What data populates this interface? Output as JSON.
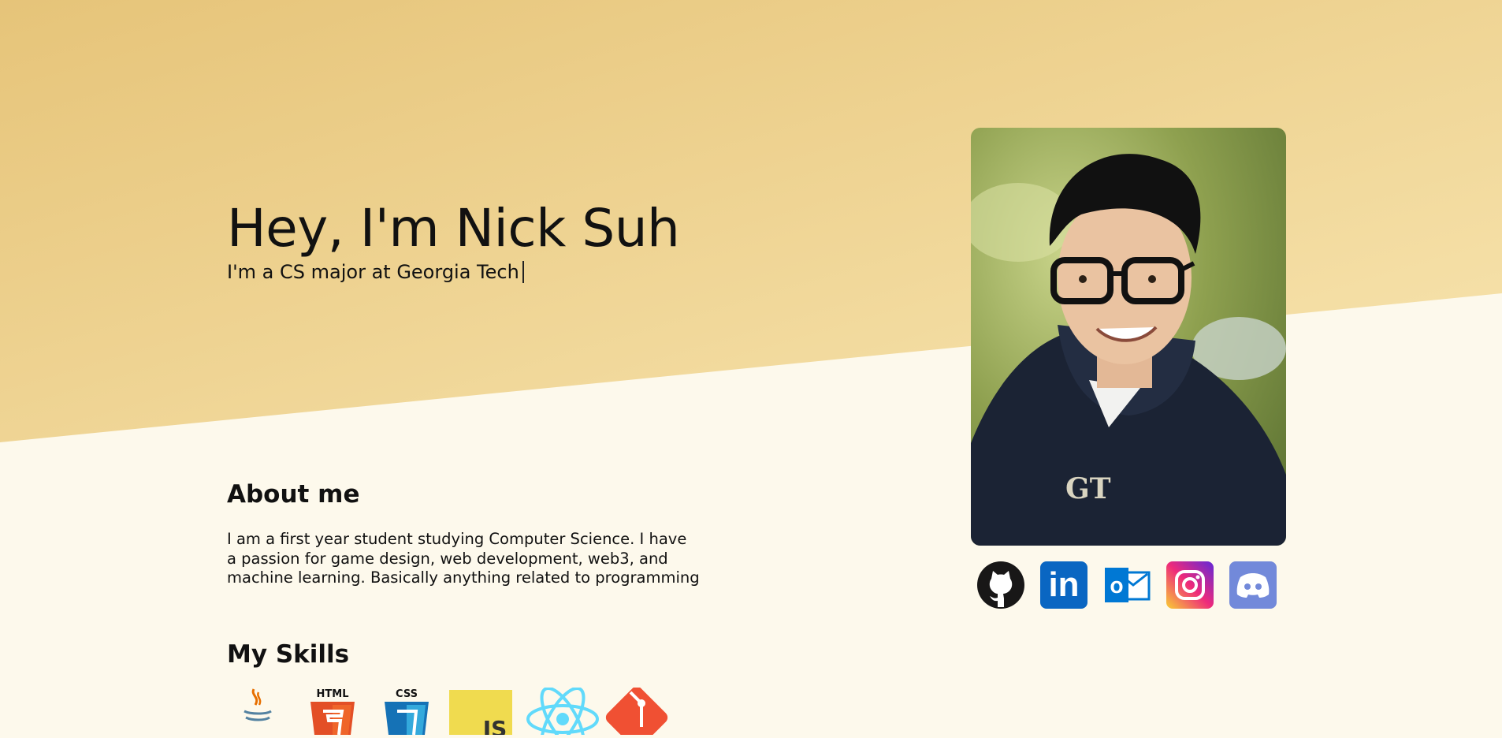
{
  "hero": {
    "title": "Hey, I'm Nick Suh",
    "subtitle": "I'm a CS major at Georgia Tech"
  },
  "about": {
    "heading": "About me",
    "text": "I am a first year student studying Computer Science. I have a passion for game design, web development, web3, and machine learning. Basically anything related to programming"
  },
  "skills": {
    "heading": "My Skills",
    "items": [
      {
        "icon": "java-icon",
        "color": "#e76f00"
      },
      {
        "icon": "html5-icon",
        "label": "HTML",
        "color": "#e34f26"
      },
      {
        "icon": "css3-icon",
        "label": "CSS",
        "color": "#1572b6"
      },
      {
        "icon": "javascript-icon",
        "label": "JS",
        "color": "#f0db4f"
      },
      {
        "icon": "react-icon",
        "color": "#61dafb"
      },
      {
        "icon": "git-icon",
        "color": "#f05033"
      }
    ]
  },
  "social": [
    {
      "icon": "github-icon",
      "color": "#181717"
    },
    {
      "icon": "linkedin-icon",
      "label": "in",
      "color": "#0a66c2"
    },
    {
      "icon": "outlook-icon",
      "label": "O",
      "color": "#0078d4"
    },
    {
      "icon": "instagram-icon",
      "color": "#d6249f"
    },
    {
      "icon": "discord-icon",
      "color": "#7289da"
    }
  ],
  "colors": {
    "background": "#fdf9ec",
    "hero_gradient_start": "#e8c57a",
    "hero_gradient_end": "#f7e3ac"
  }
}
